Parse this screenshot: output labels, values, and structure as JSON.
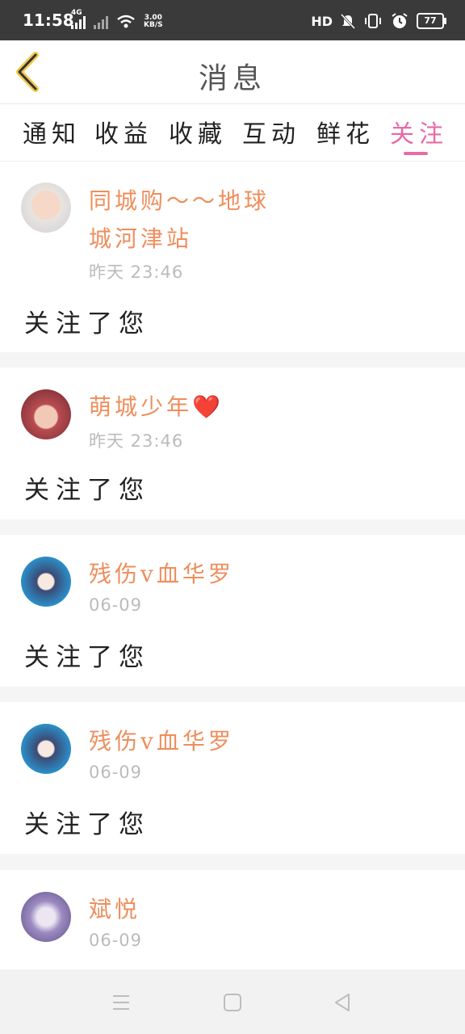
{
  "status_bar": {
    "time": "11:58",
    "network_type": "4G",
    "speed_value": "3.00",
    "speed_unit": "KB/S",
    "hd_label": "HD",
    "battery": "77"
  },
  "header": {
    "title": "消息",
    "back_icon": "chevron-left-icon"
  },
  "tabs": [
    {
      "label": "通知",
      "active": false
    },
    {
      "label": "收益",
      "active": false
    },
    {
      "label": "收藏",
      "active": false
    },
    {
      "label": "互动",
      "active": false
    },
    {
      "label": "鲜花",
      "active": false
    },
    {
      "label": "关注",
      "active": true
    }
  ],
  "feed": [
    {
      "name": "同城购～～地球城河津站",
      "time": "昨天 23:46",
      "message": "关注了您"
    },
    {
      "name": "萌城少年❤️",
      "time": "昨天 23:46",
      "message": "关注了您"
    },
    {
      "name": "残伤v血华罗",
      "time": "06-09",
      "message": "关注了您"
    },
    {
      "name": "残伤v血华罗",
      "time": "06-09",
      "message": "关注了您"
    },
    {
      "name": "斌悦",
      "time": "06-09",
      "message": ""
    }
  ],
  "colors": {
    "accent": "#e86aa6",
    "name": "#ee8e5c",
    "back_icon": "#f2c94c",
    "status_bar": "#3a3a3a"
  }
}
